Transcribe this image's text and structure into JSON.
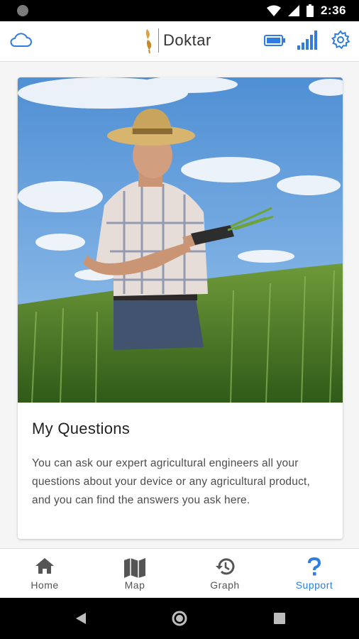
{
  "status_bar": {
    "time": "2:36"
  },
  "header": {
    "brand": "Doktar"
  },
  "card": {
    "title": "My Questions",
    "body": "You can ask our expert agricultural engineers all your questions about your device or any agricultural product, and you can find the answers you ask here."
  },
  "nav": {
    "items": [
      {
        "label": "Home",
        "icon": "home-icon"
      },
      {
        "label": "Map",
        "icon": "map-icon"
      },
      {
        "label": "Graph",
        "icon": "history-icon"
      },
      {
        "label": "Support",
        "icon": "question-icon",
        "active": true
      }
    ]
  },
  "colors": {
    "accent": "#2f7de1",
    "status_bar": "#000000",
    "inactive_nav": "#555555"
  }
}
